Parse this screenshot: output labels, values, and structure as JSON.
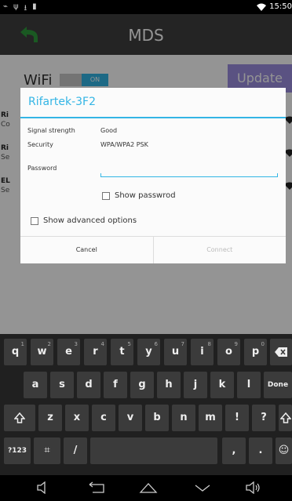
{
  "status_bar": {
    "time": "15:50"
  },
  "app_bar": {
    "title": "MDS"
  },
  "background": {
    "wifi_label": "WiFi",
    "wifi_toggle_state": "ON",
    "update_label": "Update",
    "networks": [
      {
        "name": "Ri",
        "status": "Co"
      },
      {
        "name": "Ri",
        "status": "Se"
      },
      {
        "name": "EL",
        "status": "Se"
      }
    ]
  },
  "dialog": {
    "title": "Rifartek-3F2",
    "signal_label": "Signal strength",
    "signal_value": "Good",
    "security_label": "Security",
    "security_value": "WPA/WPA2 PSK",
    "password_label": "Password",
    "password_value": "",
    "show_password_label": "Show passwrod",
    "show_advanced_label": "Show advanced options",
    "cancel_label": "Cancel",
    "connect_label": "Connect"
  },
  "keyboard": {
    "row1": [
      {
        "k": "q",
        "n": "1"
      },
      {
        "k": "w",
        "n": "2"
      },
      {
        "k": "e",
        "n": "3"
      },
      {
        "k": "r",
        "n": "4"
      },
      {
        "k": "t",
        "n": "5"
      },
      {
        "k": "y",
        "n": "6"
      },
      {
        "k": "u",
        "n": "7"
      },
      {
        "k": "i",
        "n": "8"
      },
      {
        "k": "o",
        "n": "9"
      },
      {
        "k": "p",
        "n": "0"
      }
    ],
    "row2": [
      "a",
      "s",
      "d",
      "f",
      "g",
      "h",
      "j",
      "k",
      "l"
    ],
    "row3": [
      "z",
      "x",
      "c",
      "v",
      "b",
      "n",
      "m",
      "!",
      "?"
    ],
    "done_label": "Done",
    "symbols_label": "?123",
    "slash_label": "/",
    "comma_label": ",",
    "period_label": "."
  },
  "colors": {
    "accent": "#33b5e5",
    "update_button": "#9c8ee0"
  }
}
